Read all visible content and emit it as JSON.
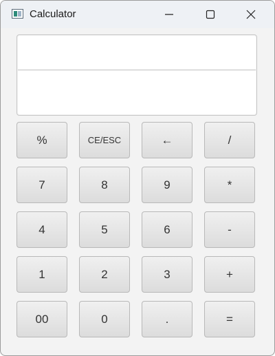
{
  "window": {
    "title": "Calculator",
    "controls": [
      "minimize-icon",
      "maximize-icon",
      "close-icon"
    ]
  },
  "display": {
    "expression": "",
    "result": ""
  },
  "keys": [
    {
      "label": "%"
    },
    {
      "label": "CE/ESC"
    },
    {
      "label": "←"
    },
    {
      "label": "/"
    },
    {
      "label": "7"
    },
    {
      "label": "8"
    },
    {
      "label": "9"
    },
    {
      "label": "*"
    },
    {
      "label": "4"
    },
    {
      "label": "5"
    },
    {
      "label": "6"
    },
    {
      "label": "-"
    },
    {
      "label": "1"
    },
    {
      "label": "2"
    },
    {
      "label": "3"
    },
    {
      "label": "+"
    },
    {
      "label": "00"
    },
    {
      "label": "0"
    },
    {
      "label": "."
    },
    {
      "label": "="
    }
  ]
}
